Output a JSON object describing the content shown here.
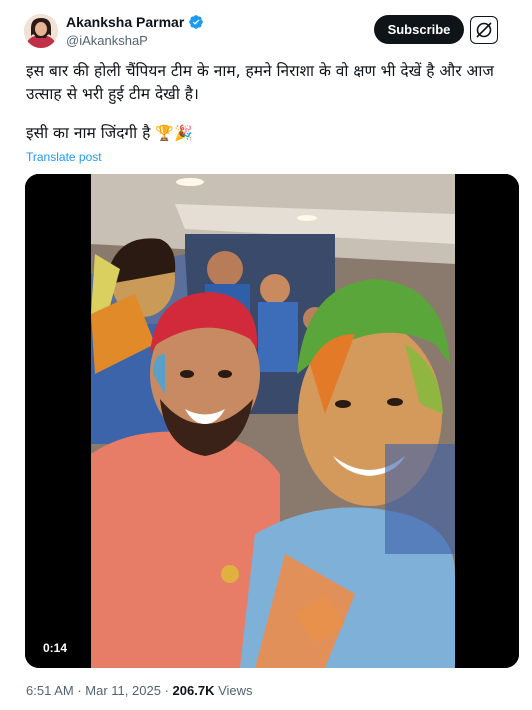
{
  "author": {
    "name": "Akanksha Parmar",
    "handle": "@iAkankshaP",
    "verified_icon": "verified-badge-icon"
  },
  "actions": {
    "subscribe_label": "Subscribe",
    "grok_icon": "grok-icon"
  },
  "post": {
    "line1": "इस बार की होली चैंपियन टीम के नाम, हमने निराशा के वो क्षण भी देखें है और आज",
    "line2": "उत्साह से भरी हुई टीम देखी है।",
    "line3": "इसी का नाम जिंदगी है",
    "emojis": "🏆🎉",
    "translate_label": "Translate post"
  },
  "video": {
    "duration": "0:14"
  },
  "meta": {
    "time": "6:51 AM",
    "separator": "·",
    "date": "Mar 11, 2025",
    "views_count": "206.7K",
    "views_label": "Views"
  },
  "colors": {
    "accent": "#1d9bf0",
    "text": "#0f1419",
    "muted": "#536471"
  }
}
